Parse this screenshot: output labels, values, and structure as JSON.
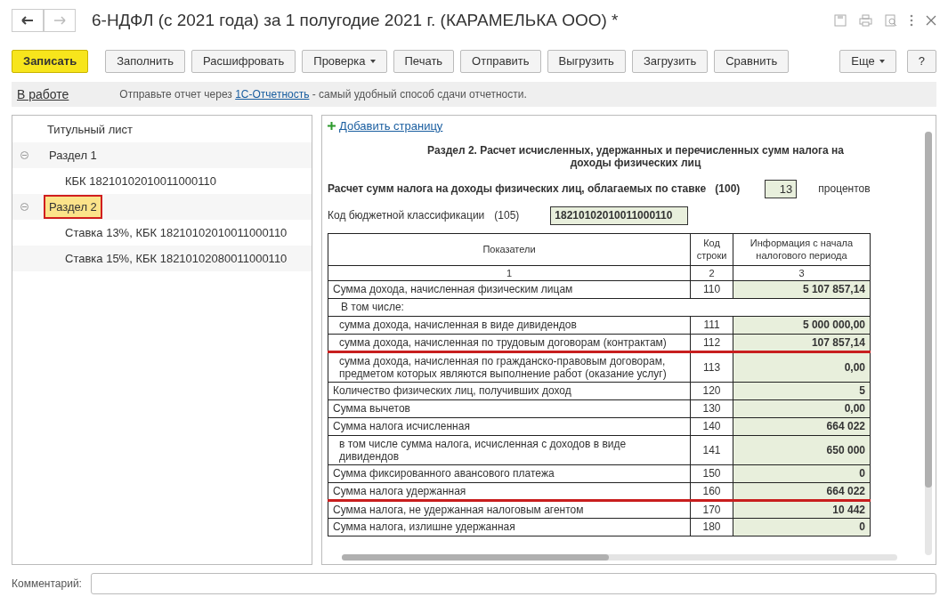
{
  "window": {
    "title": "6-НДФЛ (с 2021 года) за 1 полугодие 2021 г. (КАРАМЕЛЬКА ООО) *"
  },
  "toolbar": [
    {
      "label": "Записать",
      "kind": "primary",
      "dropdown": false
    },
    {
      "label": "Заполнить",
      "kind": "normal",
      "dropdown": false
    },
    {
      "label": "Расшифровать",
      "kind": "normal",
      "dropdown": false
    },
    {
      "label": "Проверка",
      "kind": "normal",
      "dropdown": true
    },
    {
      "label": "Печать",
      "kind": "normal",
      "dropdown": false
    },
    {
      "label": "Отправить",
      "kind": "normal",
      "dropdown": false
    },
    {
      "label": "Выгрузить",
      "kind": "normal",
      "dropdown": false
    },
    {
      "label": "Загрузить",
      "kind": "normal",
      "dropdown": false
    },
    {
      "label": "Сравнить",
      "kind": "normal",
      "dropdown": false
    }
  ],
  "toolbar_right": [
    {
      "label": "Еще",
      "dropdown": true
    },
    {
      "label": "?",
      "dropdown": false
    }
  ],
  "info_bar": {
    "status": "В работе",
    "text_before": "Отправьте отчет через ",
    "link": "1С-Отчетность",
    "text_after": " - самый удобный способ сдачи отчетности."
  },
  "tree": [
    {
      "label": "Титульный лист",
      "selected": false
    },
    {
      "label": "Раздел 1",
      "selected": false,
      "expanded": true,
      "children": [
        {
          "label": "КБК 18210102010011000110",
          "selected": false
        }
      ]
    },
    {
      "label": "Раздел 2",
      "selected": true,
      "expanded": true,
      "children": [
        {
          "label": "Ставка 13%, КБК 18210102010011000110",
          "selected": false
        },
        {
          "label": "Ставка 15%, КБК 18210102080011000110",
          "selected": false
        }
      ]
    }
  ],
  "form": {
    "add_page": "Добавить страницу",
    "heading": "Раздел 2. Расчет исчисленных, удержанных и перечисленных сумм налога на доходы физических лиц",
    "rate_label": "Расчет сумм налога на доходы физических лиц, облагаемых по ставке",
    "rate_code": "(100)",
    "rate_value": "13",
    "rate_unit": "процентов",
    "kbk_label": "Код бюджетной классификации",
    "kbk_code": "(105)",
    "kbk_value": "18210102010011000110",
    "columns": [
      "Показатели",
      "Код строки",
      "Информация с начала налогового периода"
    ],
    "column_numbers": [
      "1",
      "2",
      "3"
    ],
    "rows": [
      {
        "kind": "main",
        "label": "Сумма дохода, начисленная физическим лицам",
        "code": "110",
        "value": "5 107 857,14",
        "underlined": false
      },
      {
        "kind": "subheader",
        "label": "В том числе:",
        "underlined": false
      },
      {
        "kind": "sub",
        "label": "сумма дохода, начисленная в виде дивидендов",
        "code": "111",
        "value": "5 000 000,00",
        "underlined": false
      },
      {
        "kind": "sub",
        "label": "сумма дохода, начисленная по трудовым договорам (контрактам)",
        "code": "112",
        "value": "107 857,14",
        "underlined": true
      },
      {
        "kind": "sub",
        "label": "сумма дохода, начисленная по гражданско-правовым договорам, предметом которых являются выполнение работ (оказание услуг)",
        "code": "113",
        "value": "0,00",
        "underlined": false
      },
      {
        "kind": "main",
        "label": "Количество физических лиц, получивших доход",
        "code": "120",
        "value": "5",
        "underlined": false
      },
      {
        "kind": "main",
        "label": "Сумма вычетов",
        "code": "130",
        "value": "0,00",
        "underlined": false
      },
      {
        "kind": "main",
        "label": "Сумма налога исчисленная",
        "code": "140",
        "value": "664 022",
        "underlined": false
      },
      {
        "kind": "sub",
        "label": "в том числе сумма налога, исчисленная с доходов в виде дивидендов",
        "code": "141",
        "value": "650 000",
        "underlined": false
      },
      {
        "kind": "main",
        "label": "Сумма фиксированного авансового платежа",
        "code": "150",
        "value": "0",
        "underlined": false
      },
      {
        "kind": "main",
        "label": "Сумма налога удержанная",
        "code": "160",
        "value": "664 022",
        "underlined": true
      },
      {
        "kind": "main",
        "label": "Сумма налога, не удержанная налоговым агентом",
        "code": "170",
        "value": "10 442",
        "underlined": false
      },
      {
        "kind": "main",
        "label": "Сумма налога, излишне удержанная",
        "code": "180",
        "value": "0",
        "underlined": false
      }
    ]
  },
  "comment": {
    "label": "Комментарий:"
  }
}
